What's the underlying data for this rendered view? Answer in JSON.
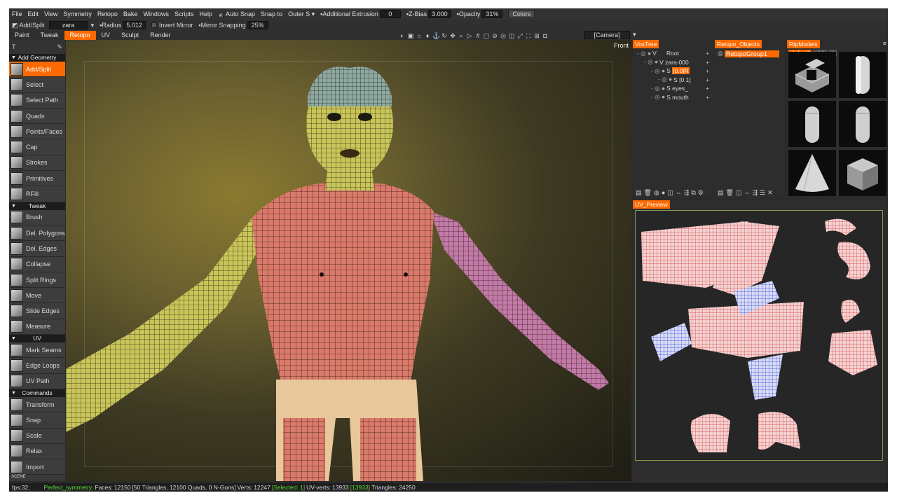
{
  "menu": {
    "items": [
      "File",
      "Edit",
      "View",
      "Symmetry",
      "Retopo",
      "Bake",
      "Windows",
      "Scripts",
      "Help"
    ],
    "auto_snap": "Auto Snap",
    "snap_to": "Snap to",
    "snap_mode": "Outer S",
    "additional_extrusion_label": "Additional Extrusion",
    "additional_extrusion_value": "0",
    "zbias_label": "Z-Bias",
    "zbias_value": "3.000",
    "opacity_label": "Opacity",
    "opacity_value": "31%",
    "colors_button": "Colors"
  },
  "toolbar2": {
    "tool_name": "Add/Split",
    "object_name": "zara",
    "radius_label": "Radius",
    "radius_value": "5.012",
    "invert_mirror": "Invert Mirror",
    "mirror_snapping_label": "Mirror Snapping",
    "mirror_snapping_value": "25%"
  },
  "tabs": [
    "Paint",
    "Tweak",
    "Retopo",
    "UV",
    "Sculpt",
    "Render"
  ],
  "active_tab": "Retopo",
  "camera": "[Camera]",
  "viewport_label": "Front",
  "left_panel": {
    "sections": [
      {
        "title": "Add Geometry",
        "tools": [
          "Add/Split",
          "Select",
          "Select Path",
          "Quads",
          "Points/Faces",
          "Cap",
          "Strokes",
          "Primitives",
          "RFill"
        ]
      },
      {
        "title": "Tweak",
        "tools": [
          "Brush",
          "Del. Polygons",
          "Del. Edges",
          "Collapse",
          "Split Rings",
          "Move",
          "Slide Edges",
          "Measure"
        ]
      },
      {
        "title": "UV",
        "tools": [
          "Mark Seams",
          "Edge Loops",
          "UV Path"
        ]
      },
      {
        "title": "Commands",
        "tools": [
          "Transform",
          "Snap",
          "Scale",
          "Relax",
          "Import"
        ]
      }
    ],
    "active_tool": "Add/Split",
    "scene_label": "SCENE"
  },
  "voxtree": {
    "title": "VoxTree",
    "rows": [
      {
        "indent": 0,
        "type": "V",
        "name": "Root",
        "selected": false
      },
      {
        "indent": 1,
        "type": "V",
        "name": "zara-000",
        "selected": false
      },
      {
        "indent": 2,
        "type": "S",
        "name": "[0.0]R",
        "selected": true
      },
      {
        "indent": 3,
        "type": "S",
        "name": "[0.1]",
        "selected": false
      },
      {
        "indent": 2,
        "type": "S",
        "name": "eyes_",
        "selected": false
      },
      {
        "indent": 2,
        "type": "S",
        "name": "mouth",
        "selected": false
      }
    ]
  },
  "retopo_objects": {
    "title": "Retopo_Objects",
    "items": [
      "RetopoGroup1"
    ]
  },
  "rtp_models": {
    "title": "RtpModels",
    "tabs": [
      "default",
      "old."
    ],
    "models": [
      "l-block-icon",
      "capsule-icon",
      "capsule-short-icon",
      "capsule-tall-icon",
      "cone-icon",
      "cube-icon"
    ]
  },
  "uv_preview": {
    "title": "UV_Preview"
  },
  "status": {
    "fps": "fps:32;",
    "symmetry": "Perfect_symmetry;",
    "faces_label": "Faces:",
    "faces": "12150",
    "faces_detail": "[50 Triangles, 12100 Quads, 0 N-Gons]",
    "verts_label": "Verts:",
    "verts": "12247",
    "selected": "[Selected: 1]",
    "uv_verts_label": "UV-verts:",
    "uv_verts": "13933",
    "uv_verts_sel": "[13933]",
    "triangles_label": "Triangles:",
    "triangles": "24250"
  },
  "colors": {
    "accent": "#ff6a00",
    "status_green": "#55dd33"
  }
}
